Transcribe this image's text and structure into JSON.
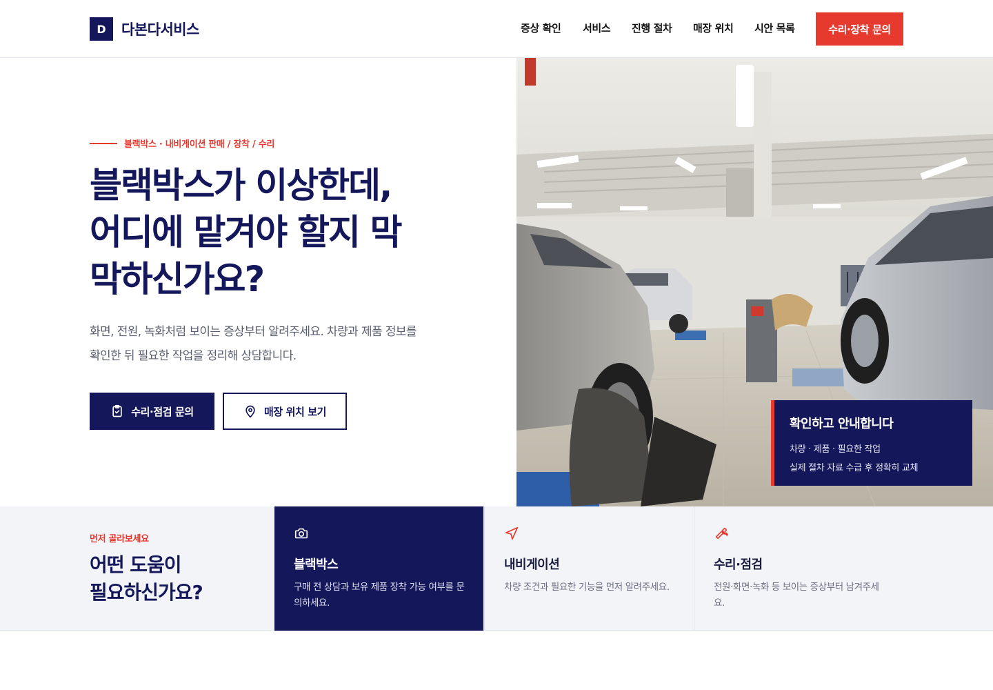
{
  "brand": {
    "mark": "D",
    "name": "다본다서비스"
  },
  "nav": {
    "items": [
      "증상 확인",
      "서비스",
      "진행 절차",
      "매장 위치",
      "시안 목록"
    ],
    "cta": "수리·장착 문의"
  },
  "hero": {
    "eyebrow": "블랙박스 · 내비게이션 판매 / 장착 / 수리",
    "title_lines": [
      "블랙박스가 이상한데,",
      "어디에 맡겨야 할지 막",
      "막하신가요?"
    ],
    "desc_lines": [
      "화면, 전원, 녹화처럼 보이는 증상부터 알려주세요. 차량과 제품 정보를",
      "확인한 뒤 필요한 작업을 정리해 상담합니다."
    ],
    "primary_button": "수리·점검 문의",
    "secondary_button": "매장 위치 보기"
  },
  "info_card": {
    "title": "확인하고 안내합니다",
    "lines": [
      "차량 · 제품 · 필요한 작업",
      "실제 절차 자료 수급 후 정확히 교체"
    ]
  },
  "help": {
    "eyebrow": "먼저 골라보세요",
    "title_lines": [
      "어떤 도움이",
      "필요하신가요?"
    ],
    "cards": [
      {
        "icon": "camera-icon",
        "title": "블랙박스",
        "desc": "구매 전 상담과 보유 제품 장착 가능 여부를 문의하세요."
      },
      {
        "icon": "navigation-icon",
        "title": "내비게이션",
        "desc": "차량 조건과 필요한 기능을 먼저 알려주세요."
      },
      {
        "icon": "wrench-icon",
        "title": "수리·점검",
        "desc": "전원·화면·녹화 등 보이는 증상부터 남겨주세요."
      }
    ]
  },
  "colors": {
    "navy": "#14175a",
    "accent": "#e63a2e",
    "strip_bg": "#f3f4f8"
  }
}
